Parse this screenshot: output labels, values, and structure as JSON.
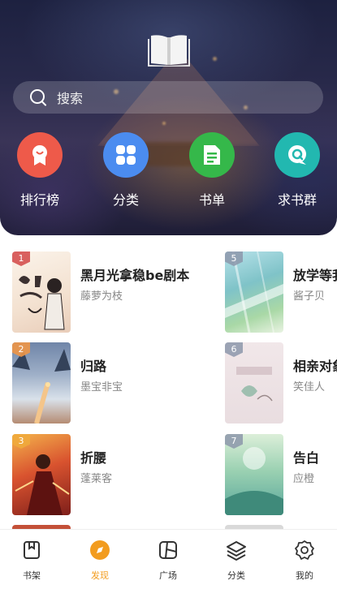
{
  "search": {
    "placeholder": "搜索"
  },
  "quick_links": [
    {
      "label": "排行榜",
      "icon": "ranking-ribbon-icon",
      "color": "#ee5a4a"
    },
    {
      "label": "分类",
      "icon": "category-grid-icon",
      "color": "#4b8cf0"
    },
    {
      "label": "书单",
      "icon": "booklist-doc-icon",
      "color": "#35b84a"
    },
    {
      "label": "求书群",
      "icon": "chat-bubble-icon",
      "color": "#22b8b0"
    }
  ],
  "books": [
    {
      "rank": "1",
      "title": "黑月光拿稳be剧本",
      "author": "藤萝为枝"
    },
    {
      "rank": "2",
      "title": "归路",
      "author": "墨宝非宝"
    },
    {
      "rank": "3",
      "title": "折腰",
      "author": "蓬莱客"
    },
    {
      "rank": "5",
      "title": "放学等我",
      "author": "酱子贝"
    },
    {
      "rank": "6",
      "title": "相亲对象",
      "author": "笑佳人"
    },
    {
      "rank": "7",
      "title": "告白",
      "author": "应橙"
    }
  ],
  "nav": [
    {
      "label": "书架",
      "icon": "bookshelf-icon"
    },
    {
      "label": "发现",
      "icon": "discover-icon",
      "active": true
    },
    {
      "label": "广场",
      "icon": "plaza-icon"
    },
    {
      "label": "分类",
      "icon": "layers-icon"
    },
    {
      "label": "我的",
      "icon": "gear-icon"
    }
  ],
  "colors": {
    "accent": "#f29c1f"
  }
}
